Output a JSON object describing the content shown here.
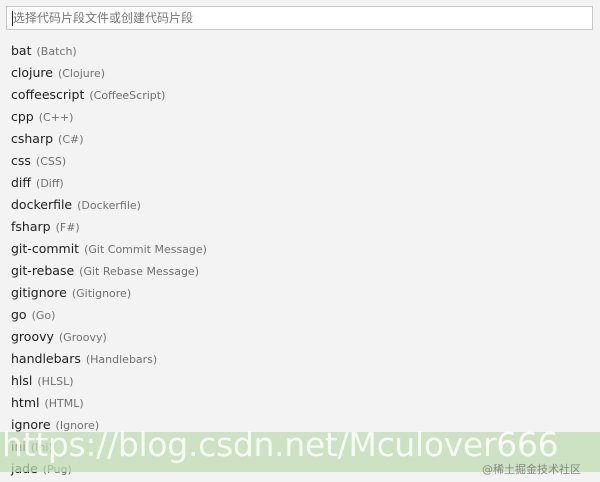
{
  "search": {
    "placeholder": "选择代码片段文件或创建代码片段"
  },
  "snippets": [
    {
      "label": "bat",
      "desc": "(Batch)"
    },
    {
      "label": "clojure",
      "desc": "(Clojure)"
    },
    {
      "label": "coffeescript",
      "desc": "(CoffeeScript)"
    },
    {
      "label": "cpp",
      "desc": "(C++)"
    },
    {
      "label": "csharp",
      "desc": "(C#)"
    },
    {
      "label": "css",
      "desc": "(CSS)"
    },
    {
      "label": "diff",
      "desc": "(Diff)"
    },
    {
      "label": "dockerfile",
      "desc": "(Dockerfile)"
    },
    {
      "label": "fsharp",
      "desc": "(F#)"
    },
    {
      "label": "git-commit",
      "desc": "(Git Commit Message)"
    },
    {
      "label": "git-rebase",
      "desc": "(Git Rebase Message)"
    },
    {
      "label": "gitignore",
      "desc": "(Gitignore)"
    },
    {
      "label": "go",
      "desc": "(Go)"
    },
    {
      "label": "groovy",
      "desc": "(Groovy)"
    },
    {
      "label": "handlebars",
      "desc": "(Handlebars)"
    },
    {
      "label": "hlsl",
      "desc": "(HLSL)"
    },
    {
      "label": "html",
      "desc": "(HTML)"
    },
    {
      "label": "ignore",
      "desc": "(Ignore)"
    },
    {
      "label": "ini",
      "desc": "(Ini)"
    },
    {
      "label": "jade",
      "desc": "(Pug)"
    }
  ],
  "watermark": {
    "url": "https://blog.csdn.net/Mculover666",
    "brand": "@稀土掘金技术社区"
  }
}
